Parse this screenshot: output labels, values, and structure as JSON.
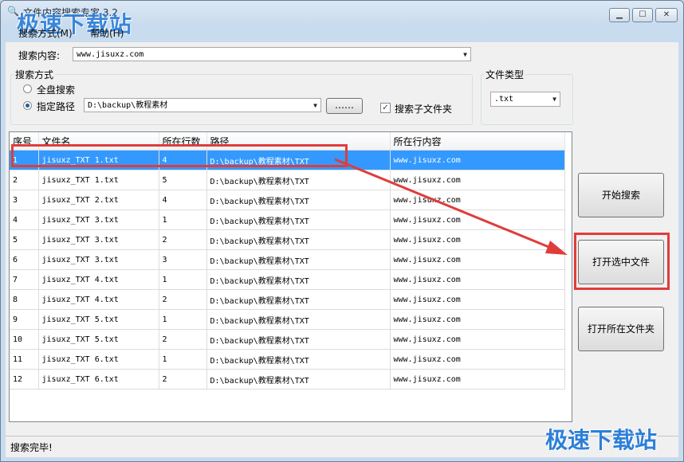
{
  "window": {
    "title": "文件内容搜索专家 3.2"
  },
  "watermark": {
    "top": "极速下载站",
    "bottom": "极速下载站"
  },
  "menu": {
    "items": [
      "搜索方式(M)",
      "帮助(H)"
    ]
  },
  "search": {
    "content_label": "搜索内容:",
    "content_value": "www.jisuxz.com",
    "mode_group_title": "搜索方式",
    "mode_full_disk": "全盘搜索",
    "mode_path": "指定路径",
    "path_value": "D:\\backup\\教程素材",
    "browse_label": "……",
    "subfolder_label": "搜索子文件夹",
    "subfolder_checked": "✓",
    "filetype_group_title": "文件类型",
    "filetype_value": ".txt"
  },
  "table": {
    "columns": [
      "序号",
      "文件名",
      "所在行数",
      "路径",
      "所在行内容"
    ],
    "rows": [
      [
        "1",
        "jisuxz_TXT 1.txt",
        "4",
        "D:\\backup\\教程素材\\TXT",
        "www.jisuxz.com"
      ],
      [
        "2",
        "jisuxz_TXT 1.txt",
        "5",
        "D:\\backup\\教程素材\\TXT",
        "www.jisuxz.com"
      ],
      [
        "3",
        "jisuxz_TXT 2.txt",
        "4",
        "D:\\backup\\教程素材\\TXT",
        "www.jisuxz.com"
      ],
      [
        "4",
        "jisuxz_TXT 3.txt",
        "1",
        "D:\\backup\\教程素材\\TXT",
        "www.jisuxz.com"
      ],
      [
        "5",
        "jisuxz_TXT 3.txt",
        "2",
        "D:\\backup\\教程素材\\TXT",
        "www.jisuxz.com"
      ],
      [
        "6",
        "jisuxz_TXT 3.txt",
        "3",
        "D:\\backup\\教程素材\\TXT",
        "www.jisuxz.com"
      ],
      [
        "7",
        "jisuxz_TXT 4.txt",
        "1",
        "D:\\backup\\教程素材\\TXT",
        "www.jisuxz.com"
      ],
      [
        "8",
        "jisuxz_TXT 4.txt",
        "2",
        "D:\\backup\\教程素材\\TXT",
        "www.jisuxz.com"
      ],
      [
        "9",
        "jisuxz_TXT 5.txt",
        "1",
        "D:\\backup\\教程素材\\TXT",
        "www.jisuxz.com"
      ],
      [
        "10",
        "jisuxz_TXT 5.txt",
        "2",
        "D:\\backup\\教程素材\\TXT",
        "www.jisuxz.com"
      ],
      [
        "11",
        "jisuxz_TXT 6.txt",
        "1",
        "D:\\backup\\教程素材\\TXT",
        "www.jisuxz.com"
      ],
      [
        "12",
        "jisuxz_TXT 6.txt",
        "2",
        "D:\\backup\\教程素材\\TXT",
        "www.jisuxz.com"
      ]
    ]
  },
  "actions": {
    "start_search": "开始搜索",
    "open_selected": "打开选中文件",
    "open_folder": "打开所在文件夹"
  },
  "status": {
    "text": "搜索完毕!"
  },
  "icons": {
    "app": "magnifier-icon",
    "minimize": "minimize-icon",
    "maximize": "maximize-icon",
    "close": "close-icon"
  },
  "colors": {
    "selection": "#3399ff",
    "annotation": "#e03c3c",
    "watermark": "#2d7fd8"
  }
}
